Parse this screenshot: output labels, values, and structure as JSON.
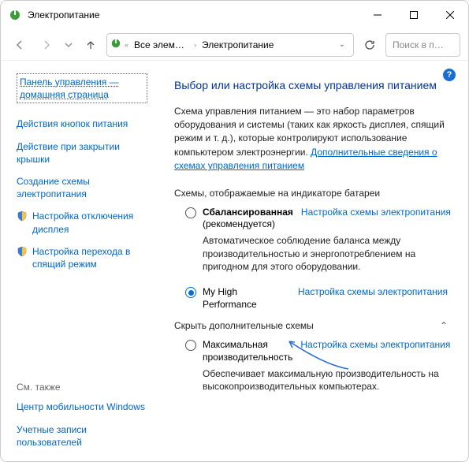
{
  "window": {
    "title": "Электропитание"
  },
  "breadcrumb": {
    "root": "Все элеме…",
    "current": "Электропитание"
  },
  "search": {
    "placeholder": "Поиск в п…"
  },
  "sidebar": {
    "home": "Панель управления — домашняя страница",
    "links": [
      "Действия кнопок питания",
      "Действие при закрытии крышки",
      "Создание схемы электропитания",
      "Настройка отключения дисплея",
      "Настройка перехода в спящий режим"
    ],
    "see_also_label": "См. также",
    "see_also": [
      "Центр мобильности Windows",
      "Учетные записи пользователей"
    ]
  },
  "main": {
    "title": "Выбор или настройка схемы управления питанием",
    "intro": "Схема управления питанием — это набор параметров оборудования и системы (таких как яркость дисплея, спящий режим и т. д.), которые контролируют использование компьютером электроэнергии. ",
    "intro_link": "Дополнительные сведения о схемах управления питанием",
    "section1": "Схемы, отображаемые на индикаторе батареи",
    "section2": "Скрыть дополнительные схемы",
    "change_link": "Настройка схемы электропитания",
    "plans": [
      {
        "name_bold": "Сбалансированная",
        "name_suffix": " (рекомендуется)",
        "checked": false,
        "desc": "Автоматическое соблюдение баланса между производительностью и энергопотреблением на пригодном для этого оборудовании."
      },
      {
        "name_bold": "",
        "name_plain": "My High Performance",
        "checked": true,
        "desc": ""
      }
    ],
    "extra_plan": {
      "name_plain": "Максимальная производительность",
      "desc": "Обеспечивает максимальную производительность на высокопроизводительных компьютерах."
    }
  }
}
